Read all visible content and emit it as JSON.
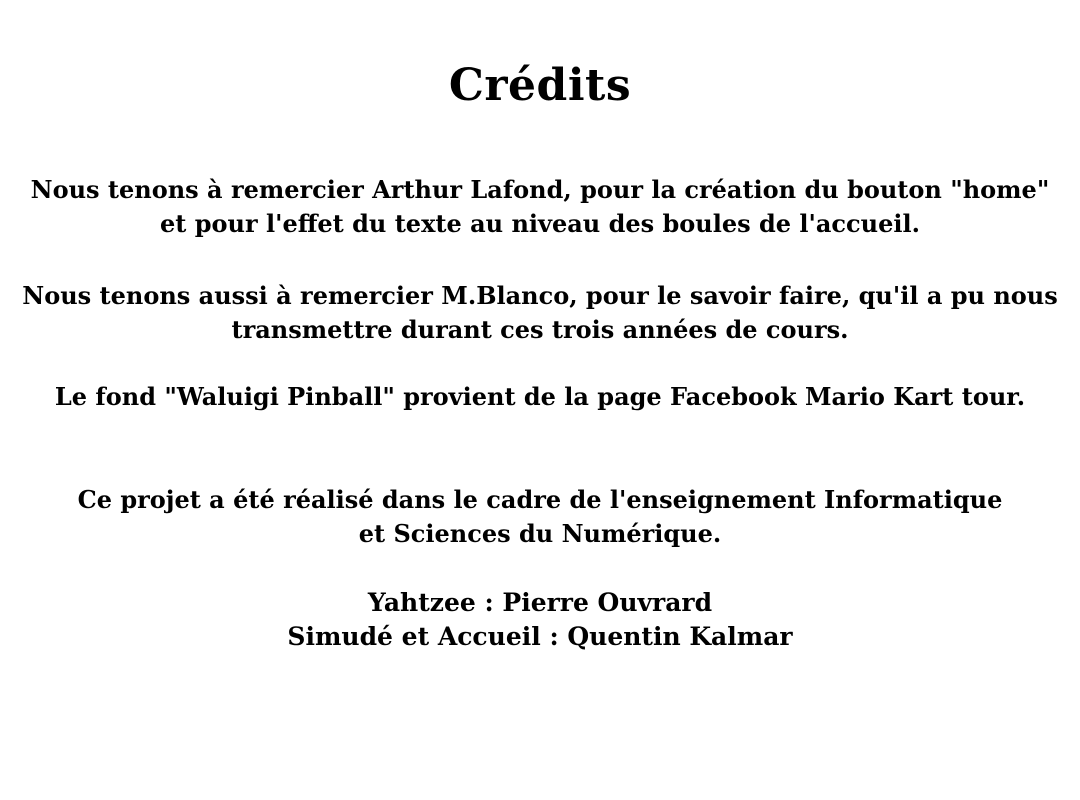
{
  "page": {
    "title": "Crédits",
    "paragraphs": [
      {
        "lines": [
          "Nous tenons à remercier Arthur Lafond, pour la création du bouton \"home\"",
          "et pour l'effet du texte au niveau des boules de l'accueil."
        ]
      },
      {
        "lines": [
          "Nous tenons aussi à remercier M.Blanco, pour le savoir faire, qu'il a pu nous",
          "transmettre durant ces trois années de cours."
        ]
      },
      {
        "lines": [
          "Le fond \"Waluigi Pinball\" provient de la page Facebook Mario Kart tour."
        ]
      },
      {
        "lines": [
          "Ce projet a été réalisé dans le cadre de l'enseignement Informatique",
          "et Sciences du Numérique."
        ]
      },
      {
        "lines": [
          "Yahtzee : Pierre Ouvrard",
          "Simudé et Accueil : Quentin Kalmar"
        ]
      }
    ]
  },
  "colors": {
    "background": "#ffffff",
    "text": "#000000"
  }
}
